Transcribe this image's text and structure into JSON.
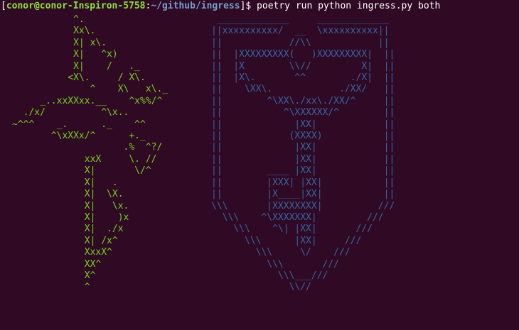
{
  "terminal": {
    "prompt": {
      "open_bracket": "[",
      "user_host": "conor@conor-Inspiron-5758",
      "colon": ":",
      "path": "~/github/ingress",
      "close": "]$ ",
      "command": "poetry run python ingress.py both"
    },
    "art_left": "           ^.\n           Xx\\.\n           X| x\\.\n           X|   ^x)\n           X|    /   ._\n          <X\\.     / X\\.\n              ^    X\\   x\\._\n     _..xxXXxx.__    ^x%%/^\n  ./x/          ^\\x..\n~^^^    _.      ._    ^^\n       ^\\xXXx/^      +._\n                    .%  ^?/\n             xxX     \\. //\n             X|       \\/^\n             X|   .\n             X|  \\X.\n             X|   \\x.\n             X|    )x\n             X|  ./x\n             X| /x^\n             XxxX^\n             XX^\n             X^\n             ^",
    "art_right": " _____________     _____________\n||xxxxxxxxxx/  __  \\xxxxxxxxxx||\n||            //\\\\            ||\n||  |XXXXXXXXX(   )XXXXXXXXX|  ||\n||  |X        \\\\//         X|  ||\n||  |X\\.       ^^        ./X|  ||\n||    \\XX\\.            ./XX/   ||\n||        ^\\XX\\./xx\\./XX/^     ||\n||           ^\\XXXXXX/^        ||\n||             |XX|            ||\n||            (XXXX)           ||\n||             |XX|            ||\n||             |XX|            ||\n||        ____ |XX|            ||\n||        |XXX| |XX|           ||\n||        |X____|XX|           ||\n\\\\\\       |XXXXXXXX|          ///\n  \\\\\\    ^\\XXXXXXX|         ///\n    \\\\\\    ^\\| |XX|       ///\n      \\\\\\      |XX|     ///\n        \\\\\\     \\/    ///\n          \\\\\\       ///\n            \\\\\\___///\n              \\\\//",
    "colors": {
      "background": "#300a24",
      "prompt_user": "#8ae234",
      "prompt_path": "#729fcf",
      "text": "#ffffff",
      "art_left": "#73d216",
      "art_right": "#3465a4"
    }
  }
}
